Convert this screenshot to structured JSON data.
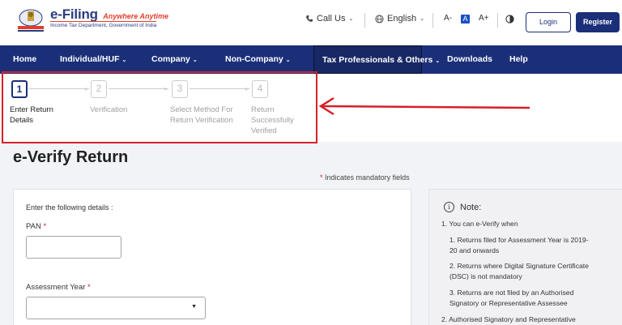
{
  "header": {
    "brand_name": "e-Filing",
    "brand_tagline": "Anywhere Anytime",
    "brand_sub": "Income Tax Department, Government of India",
    "call_us": "Call Us",
    "language": "English",
    "font_small": "A-",
    "font_default": "A",
    "font_large": "A+",
    "login": "Login",
    "register": "Register"
  },
  "nav": {
    "items": [
      "Home",
      "Individual/HUF",
      "Company",
      "Non-Company",
      "Tax Professionals & Others",
      "Downloads",
      "Help"
    ]
  },
  "stepper": {
    "steps": [
      {
        "num": "1",
        "label_1": "Enter Return",
        "label_2": "Details",
        "label_3": ""
      },
      {
        "num": "2",
        "label_1": "Verification",
        "label_2": "",
        "label_3": ""
      },
      {
        "num": "3",
        "label_1": "Select Method For",
        "label_2": "Return Verification",
        "label_3": ""
      },
      {
        "num": "4",
        "label_1": "Return",
        "label_2": "Successfully",
        "label_3": "Verified"
      }
    ]
  },
  "page": {
    "title": "e-Verify Return",
    "mandatory_star": "*",
    "mandatory_text": "Indicates mandatory fields"
  },
  "form": {
    "intro": "Enter the following details :",
    "pan_label": "PAN",
    "pan_value": "",
    "ay_label": "Assessment Year",
    "ay_value": "",
    "required_star": "*"
  },
  "note": {
    "title": "Note:",
    "line1": "1. You can e-Verify when",
    "sub1a": "1. Returns filed for Assessment Year is 2019-",
    "sub1b": "20 and onwards",
    "sub2a": "2. Returns where Digital Signature Certificate",
    "sub2b": "(DSC) is not mandatory",
    "sub3a": "3. Returns are not filed by an Authorised",
    "sub3b": "Signatory or Representative Assessee",
    "line2": "2. Authorised Signatory and Representative"
  },
  "colors": {
    "nav_bg": "#1b2f79",
    "highlight_red": "#d5202b",
    "required_red": "#d5202b"
  }
}
